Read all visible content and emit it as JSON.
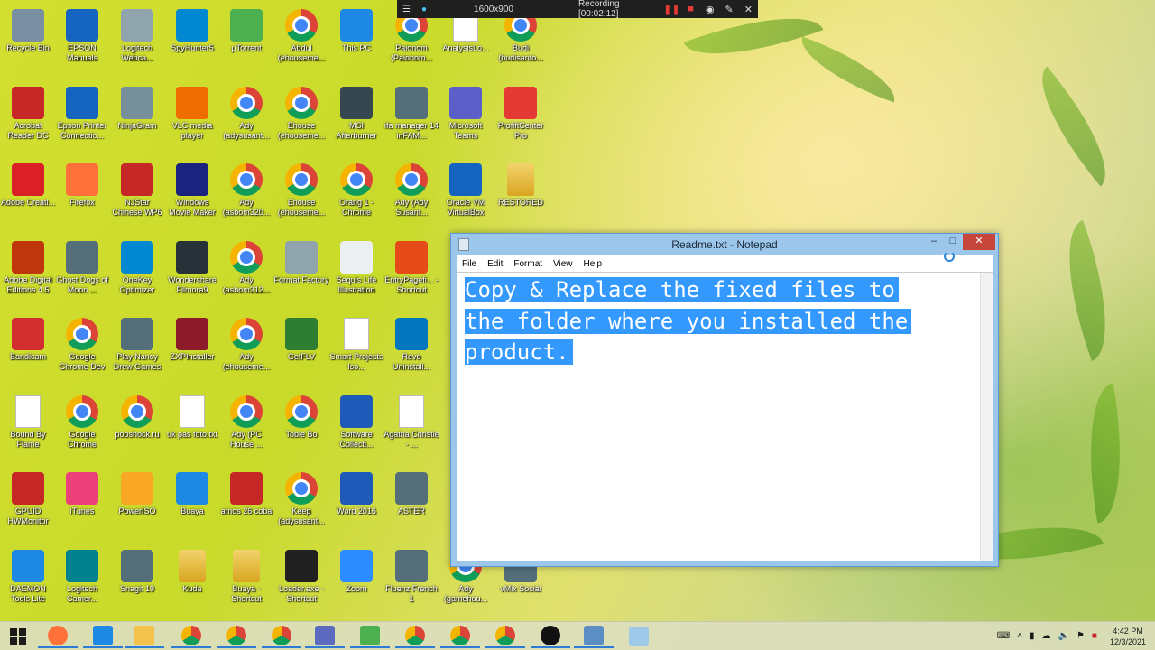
{
  "recording_bar": {
    "resolution": "1600x900",
    "status": "Recording [00:02:12]"
  },
  "desktop_icons": [
    {
      "label": "Recycle Bin",
      "icon": "recycle-bin-icon",
      "color": "#7b8fa3"
    },
    {
      "label": "EPSON Manuals",
      "icon": "epson-icon",
      "color": "#1565c0"
    },
    {
      "label": "Logitech Webca...",
      "icon": "webcam-icon",
      "color": "#90a4ae"
    },
    {
      "label": "SpyHunter5",
      "icon": "spyhunter-icon",
      "color": "#0288d1"
    },
    {
      "label": "µTorrent",
      "icon": "utorrent-icon",
      "color": "#4caf50"
    },
    {
      "label": "Abdul (ehouseme...",
      "icon": "chrome-icon",
      "color": "chrome"
    },
    {
      "label": "This PC",
      "icon": "this-pc-icon",
      "color": "#1e88e5"
    },
    {
      "label": "Paionom (Paionom...",
      "icon": "chrome-icon",
      "color": "chrome"
    },
    {
      "label": "AnalysisLo...",
      "icon": "document-icon",
      "color": "doc"
    },
    {
      "label": "Budi (budisanto...",
      "icon": "chrome-icon",
      "color": "chrome"
    },
    {
      "label": "Acrobat Reader DC",
      "icon": "acrobat-icon",
      "color": "#c62828"
    },
    {
      "label": "Epson Printer Connectio...",
      "icon": "epson-printer-icon",
      "color": "#1565c0"
    },
    {
      "label": "NinjaGram",
      "icon": "ninjagram-icon",
      "color": "#78909c"
    },
    {
      "label": "VLC media player",
      "icon": "vlc-icon",
      "color": "#ef6c00"
    },
    {
      "label": "Ady (adysusant...",
      "icon": "chrome-icon",
      "color": "chrome"
    },
    {
      "label": "Ehouse (ehouseme...",
      "icon": "chrome-icon",
      "color": "chrome"
    },
    {
      "label": "MSI Afterburner",
      "icon": "msi-icon",
      "color": "#37474f"
    },
    {
      "label": "ifa manager 14 inFAM...",
      "icon": "app-icon",
      "color": "#546e7a"
    },
    {
      "label": "Microsoft Teams",
      "icon": "teams-icon",
      "color": "#5b5fc7"
    },
    {
      "label": "ProfiftCenter Pro",
      "icon": "java-icon",
      "color": "#e53935"
    },
    {
      "label": "Adobe Creati...",
      "icon": "adobe-cc-icon",
      "color": "#da1f26"
    },
    {
      "label": "Firefox",
      "icon": "firefox-icon",
      "color": "#ff7139"
    },
    {
      "label": "NJStar Chinese WP6",
      "icon": "njstar-icon",
      "color": "#c62828"
    },
    {
      "label": "Windows Movie Maker",
      "icon": "movie-maker-icon",
      "color": "#1a237e"
    },
    {
      "label": "Ady (asbom320...",
      "icon": "chrome-icon",
      "color": "chrome"
    },
    {
      "label": "Ehouse (ehouseme...",
      "icon": "chrome-icon",
      "color": "chrome"
    },
    {
      "label": "Orang 1 - Chrome",
      "icon": "chrome-icon",
      "color": "chrome"
    },
    {
      "label": "Ady (Ady Susant...",
      "icon": "chrome-icon",
      "color": "chrome"
    },
    {
      "label": "Oracle VM VirtualBox",
      "icon": "virtualbox-icon",
      "color": "#1565c0"
    },
    {
      "label": "RESTORED",
      "icon": "folder-icon",
      "color": "folder"
    },
    {
      "label": "Adobe Digital Editions 4.5",
      "icon": "digital-editions-icon",
      "color": "#bf360c"
    },
    {
      "label": "Ghost Dogs of Moon ...",
      "icon": "app-icon",
      "color": "#546e7a"
    },
    {
      "label": "OneKey Optimizer",
      "icon": "onekey-icon",
      "color": "#0288d1"
    },
    {
      "label": "Wondershare Filmora9",
      "icon": "filmora-icon",
      "color": "#263238"
    },
    {
      "label": "Ady (asbom312...",
      "icon": "chrome-icon",
      "color": "chrome"
    },
    {
      "label": "Format Factory",
      "icon": "format-factory-icon",
      "color": "#90a4ae"
    },
    {
      "label": "Sequis Life Illustration",
      "icon": "sequis-icon",
      "color": "#eceff1"
    },
    {
      "label": "EntryPagefi... - Shortcut",
      "icon": "entry-icon",
      "color": "#e64a19"
    },
    {
      "label": "Bandicam",
      "icon": "bandicam-icon",
      "color": "#d32f2f"
    },
    {
      "label": "Google Chrome Dev",
      "icon": "chrome-icon",
      "color": "chrome"
    },
    {
      "label": "Play Nancy Drew Games",
      "icon": "app-icon",
      "color": "#546e7a"
    },
    {
      "label": "ZXPInstaller",
      "icon": "zxp-icon",
      "color": "#8e1b2a"
    },
    {
      "label": "Ady (ehouseme...",
      "icon": "chrome-icon",
      "color": "chrome"
    },
    {
      "label": "GetFLV",
      "icon": "getflv-icon",
      "color": "#2e7d32"
    },
    {
      "label": "Smart Projects Iso...",
      "icon": "document-icon",
      "color": "doc"
    },
    {
      "label": "Revo Uninstall...",
      "icon": "revo-icon",
      "color": "#0277bd"
    },
    {
      "label": "Bound By Flame",
      "icon": "document-icon",
      "color": "doc"
    },
    {
      "label": "Google Chrome",
      "icon": "chrome-icon",
      "color": "chrome"
    },
    {
      "label": "pooshock.ru",
      "icon": "chrome-icon",
      "color": "chrome"
    },
    {
      "label": "uk pas foto.txt",
      "icon": "document-icon",
      "color": "doc"
    },
    {
      "label": "Ady (PC House ...",
      "icon": "chrome-icon",
      "color": "chrome"
    },
    {
      "label": "Tobie Bo",
      "icon": "chrome-icon",
      "color": "chrome"
    },
    {
      "label": "Software Collecti...",
      "icon": "word-icon",
      "color": "#1e5bb8"
    },
    {
      "label": "Agatha Christie - ...",
      "icon": "document-icon",
      "color": "doc"
    },
    {
      "label": "GPUID HWMonitor",
      "icon": "hwmonitor-icon",
      "color": "#c62828"
    },
    {
      "label": "iTunes",
      "icon": "itunes-icon",
      "color": "#ec407a"
    },
    {
      "label": "PowerISO",
      "icon": "poweriso-icon",
      "color": "#f9a825"
    },
    {
      "label": "Buaya",
      "icon": "network-icon",
      "color": "#1e88e5"
    },
    {
      "label": "amos 26 coba",
      "icon": "njstar-icon",
      "color": "#c62828"
    },
    {
      "label": "Keep (adysusant...",
      "icon": "chrome-icon",
      "color": "chrome"
    },
    {
      "label": "Word 2016",
      "icon": "word-icon",
      "color": "#1e5bb8"
    },
    {
      "label": "ASTER",
      "icon": "app-icon",
      "color": "#546e7a"
    },
    {
      "label": "DAEMON Tools Lite",
      "icon": "daemon-tools-icon",
      "color": "#1e88e5"
    },
    {
      "label": "Logitech Camer...",
      "icon": "logitech-camera-icon",
      "color": "#00838f"
    },
    {
      "label": "Snagit 19",
      "icon": "app-icon",
      "color": "#546e7a"
    },
    {
      "label": "Kuda",
      "icon": "folder-icon",
      "color": "folder"
    },
    {
      "label": "Buaya - Shortcut",
      "icon": "folder-icon",
      "color": "folder"
    },
    {
      "label": "Loader.exe - Shortcut",
      "icon": "loader-icon",
      "color": "#212121"
    },
    {
      "label": "Zoom",
      "icon": "zoom-icon",
      "color": "#2d8cff"
    },
    {
      "label": "Fluenz French 1",
      "icon": "app-icon",
      "color": "#546e7a"
    },
    {
      "label": "Ady (gamehou...",
      "icon": "chrome-icon",
      "color": "chrome"
    },
    {
      "label": "vMix Social",
      "icon": "app-icon",
      "color": "#546e7a"
    }
  ],
  "notepad": {
    "title": "Readme.txt - Notepad",
    "menu": [
      "File",
      "Edit",
      "Format",
      "View",
      "Help"
    ],
    "text_lines": [
      "Copy & Replace the fixed files to",
      "the folder where you installed the",
      "product."
    ]
  },
  "taskbar": {
    "items": [
      {
        "icon": "firefox-icon",
        "color": "#ff7139"
      },
      {
        "icon": "internet-explorer-icon",
        "color": "#1e88e5"
      },
      {
        "icon": "file-explorer-icon",
        "color": "#f3c24b"
      },
      {
        "icon": "chrome-icon",
        "color": "chrome"
      },
      {
        "icon": "chrome-dev-icon",
        "color": "chrome"
      },
      {
        "icon": "chrome-icon",
        "color": "chrome"
      },
      {
        "icon": "this-pc-icon",
        "color": "#5c6bc0"
      },
      {
        "icon": "utorrent-icon",
        "color": "#4caf50"
      },
      {
        "icon": "chrome-icon",
        "color": "chrome"
      },
      {
        "icon": "chrome-icon",
        "color": "chrome"
      },
      {
        "icon": "chrome-icon",
        "color": "chrome"
      },
      {
        "icon": "bandicam-icon",
        "color": "#111111"
      },
      {
        "icon": "control-panel-icon",
        "color": "#5c8ec4"
      },
      {
        "icon": "notepad-icon",
        "color": "#9ec9e8"
      }
    ],
    "clock_time": "4:42 PM",
    "clock_date": "12/3/2021"
  }
}
